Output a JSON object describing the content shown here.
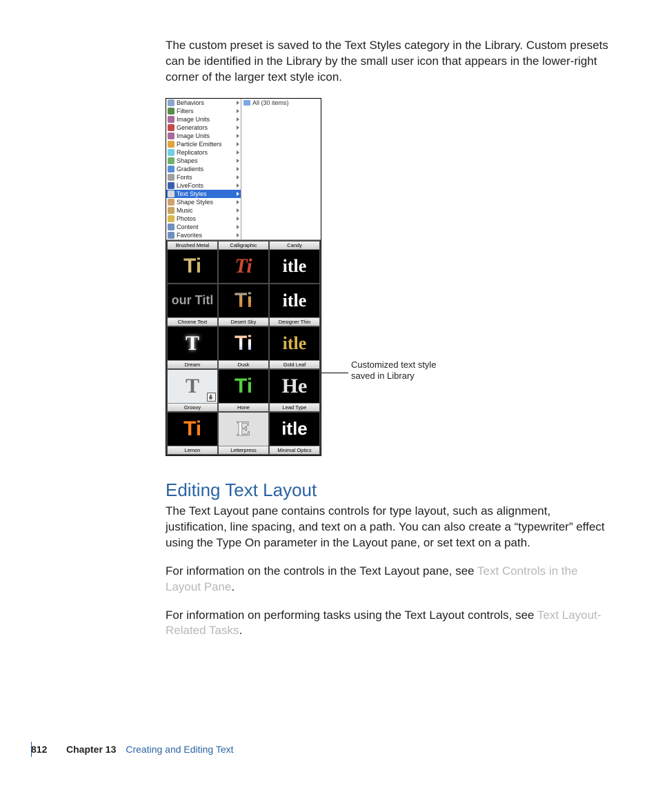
{
  "body": {
    "p1": "The custom preset is saved to the Text Styles category in the Library. Custom presets can be identified in the Library by the small user icon that appears in the lower-right corner of the larger text style icon.",
    "h2": "Editing Text Layout",
    "p2": "The Text Layout pane contains controls for type layout, such as alignment, justification, line spacing, and text on a path. You can also create a “typewriter” effect using the Type On parameter in the Layout pane, or set text on a path.",
    "p3a": "For information on the controls in the Text Layout pane, see ",
    "link1": "Text Controls in the Layout Pane",
    "p3b": ".",
    "p4a": "For information on performing tasks using the Text Layout controls, see ",
    "link2": "Text Layout-Related Tasks",
    "p4b": "."
  },
  "callout": {
    "line1": "Customized text style",
    "line2": "saved in Library"
  },
  "library": {
    "right_header": "All (30 items)",
    "categories": [
      {
        "label": "Behaviors",
        "color": "#8aa7cf"
      },
      {
        "label": "Filters",
        "color": "#5b8d4a"
      },
      {
        "label": "Image Units",
        "color": "#a86c9a"
      },
      {
        "label": "Generators",
        "color": "#c24a4a"
      },
      {
        "label": "Image Units",
        "color": "#a86c9a"
      },
      {
        "label": "Particle Emitters",
        "color": "#e0a53c"
      },
      {
        "label": "Replicators",
        "color": "#6fcfe2"
      },
      {
        "label": "Shapes",
        "color": "#6fb26f"
      },
      {
        "label": "Gradients",
        "color": "#5a8fd6"
      },
      {
        "label": "Fonts",
        "color": "#9fa0a2"
      },
      {
        "label": "LiveFonts",
        "color": "#3a5fb0"
      },
      {
        "label": "Text Styles",
        "color": "#d8d8d8",
        "selected": true
      },
      {
        "label": "Shape Styles",
        "color": "#d0a36a"
      },
      {
        "label": "Music",
        "color": "#c9a55d"
      },
      {
        "label": "Photos",
        "color": "#d9b84c"
      },
      {
        "label": "Content",
        "color": "#6e8fbf"
      },
      {
        "label": "Favorites",
        "color": "#6e8fbf"
      }
    ],
    "thumbs": [
      {
        "caption": "Brushed Metal",
        "pv_class": "pv-brushed",
        "sample": "Ti",
        "top": true
      },
      {
        "caption": "Calligraphic",
        "pv_class": "pv-callig",
        "sample": "Ti",
        "top": true
      },
      {
        "caption": "Candy",
        "pv_class": "pv-candy",
        "sample": "itle",
        "top": true
      },
      {
        "caption": "Chrome Text",
        "pv_class": "pv-chrome",
        "sample": "our Titl"
      },
      {
        "caption": "Desert Sky",
        "pv_class": "pv-desert",
        "sample": "Ti"
      },
      {
        "caption": "Designer Thin",
        "pv_class": "pv-designer",
        "sample": "itle"
      },
      {
        "caption": "Dream",
        "pv_class": "pv-dream",
        "sample": "T"
      },
      {
        "caption": "Dusk",
        "pv_class": "pv-dusk",
        "sample": "Ti"
      },
      {
        "caption": "Gold Leaf",
        "pv_class": "pv-gold",
        "sample": "itle"
      },
      {
        "caption": "Groovy",
        "pv_class": "pv-groovy",
        "sample": "T",
        "user_badge": true
      },
      {
        "caption": "Hone",
        "pv_class": "pv-hone",
        "sample": "Ti"
      },
      {
        "caption": "Lead Type",
        "pv_class": "pv-lead",
        "sample": "He"
      },
      {
        "caption": "Lemon",
        "pv_class": "pv-lemon",
        "sample": "Ti"
      },
      {
        "caption": "Letterpress",
        "pv_class": "pv-letter",
        "sample": "E"
      },
      {
        "caption": "Minimal Optics",
        "pv_class": "pv-minimal",
        "sample": "itle"
      }
    ]
  },
  "footer": {
    "page": "812",
    "chapter": "Chapter 13",
    "title": "Creating and Editing Text"
  }
}
